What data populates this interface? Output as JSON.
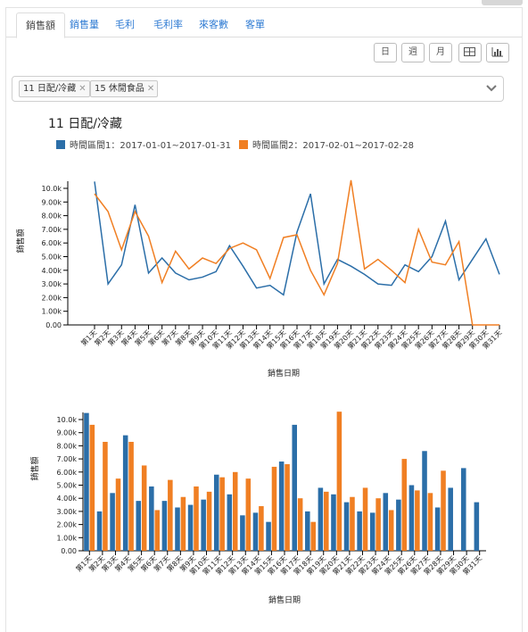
{
  "tabs": [
    "銷售額",
    "銷售量",
    "毛利",
    "毛利率",
    "來客數",
    "客單"
  ],
  "active_tab": 0,
  "period_buttons": [
    "日",
    "週",
    "月"
  ],
  "view_buttons": [
    "table-icon",
    "bar-chart-icon"
  ],
  "filters": [
    "11 日配/冷藏",
    "15 休閒食品"
  ],
  "chart_title": "11 日配/冷藏",
  "colors": {
    "series1": "#2b6ea8",
    "series2": "#f07f23",
    "tab_link": "#2f7bd3"
  },
  "chart_data": [
    {
      "type": "line",
      "ylabel": "銷售額",
      "xlabel": "銷售日期",
      "ylim": [
        0,
        10000
      ],
      "yticks": [
        "0.00",
        "1.00k",
        "2.00k",
        "3.00k",
        "4.00k",
        "5.00k",
        "6.00k",
        "7.00k",
        "8.00k",
        "9.00k",
        "10.0k"
      ],
      "categories": [
        "第1天",
        "第2天",
        "第3天",
        "第4天",
        "第5天",
        "第6天",
        "第7天",
        "第8天",
        "第9天",
        "第10天",
        "第11天",
        "第12天",
        "第13天",
        "第14天",
        "第15天",
        "第16天",
        "第17天",
        "第18天",
        "第19天",
        "第20天",
        "第21天",
        "第22天",
        "第23天",
        "第24天",
        "第25天",
        "第26天",
        "第27天",
        "第28天",
        "第29天",
        "第30天",
        "第31天"
      ],
      "series": [
        {
          "name": "時間區間1：2017-01-01~2017-01-31",
          "values": [
            10500,
            3000,
            4400,
            8800,
            3800,
            4900,
            3800,
            3300,
            3500,
            3900,
            5800,
            4300,
            2700,
            2900,
            2200,
            6800,
            9600,
            3000,
            4800,
            4300,
            3700,
            3000,
            2900,
            4400,
            3900,
            5000,
            7600,
            3300,
            4800,
            6300,
            3700
          ]
        },
        {
          "name": "時間區間2：2017-02-01~2017-02-28",
          "values": [
            9600,
            8300,
            5500,
            8300,
            6500,
            3100,
            5400,
            4100,
            4900,
            4500,
            5600,
            6000,
            5500,
            3400,
            6400,
            6600,
            4000,
            2200,
            4500,
            10600,
            4100,
            4800,
            4000,
            3100,
            7000,
            4600,
            4400,
            6100,
            0,
            0,
            0
          ]
        }
      ]
    },
    {
      "type": "bar",
      "ylabel": "銷售額",
      "xlabel": "銷售日期",
      "ylim": [
        0,
        10000
      ],
      "yticks": [
        "0.00",
        "1.00k",
        "2.00k",
        "3.00k",
        "4.00k",
        "5.00k",
        "6.00k",
        "7.00k",
        "8.00k",
        "9.00k",
        "10.0k"
      ],
      "categories": [
        "第1天",
        "第2天",
        "第3天",
        "第4天",
        "第5天",
        "第6天",
        "第7天",
        "第8天",
        "第9天",
        "第10天",
        "第11天",
        "第12天",
        "第13天",
        "第14天",
        "第15天",
        "第16天",
        "第17天",
        "第18天",
        "第19天",
        "第20天",
        "第21天",
        "第22天",
        "第23天",
        "第24天",
        "第25天",
        "第26天",
        "第27天",
        "第28天",
        "第29天",
        "第30天",
        "第31天"
      ],
      "series": [
        {
          "name": "時間區間1：2017-01-01~2017-01-31",
          "values": [
            10500,
            3000,
            4400,
            8800,
            3800,
            4900,
            3800,
            3300,
            3500,
            3900,
            5800,
            4300,
            2700,
            2900,
            2200,
            6800,
            9600,
            3000,
            4800,
            4300,
            3700,
            3000,
            2900,
            4400,
            3900,
            5000,
            7600,
            3300,
            4800,
            6300,
            3700
          ]
        },
        {
          "name": "時間區間2：2017-02-01~2017-02-28",
          "values": [
            9600,
            8300,
            5500,
            8300,
            6500,
            3100,
            5400,
            4100,
            4900,
            4500,
            5600,
            6000,
            5500,
            3400,
            6400,
            6600,
            4000,
            2200,
            4500,
            10600,
            4100,
            4800,
            4000,
            3100,
            7000,
            4600,
            4400,
            6100,
            0,
            0,
            0
          ]
        }
      ]
    }
  ]
}
